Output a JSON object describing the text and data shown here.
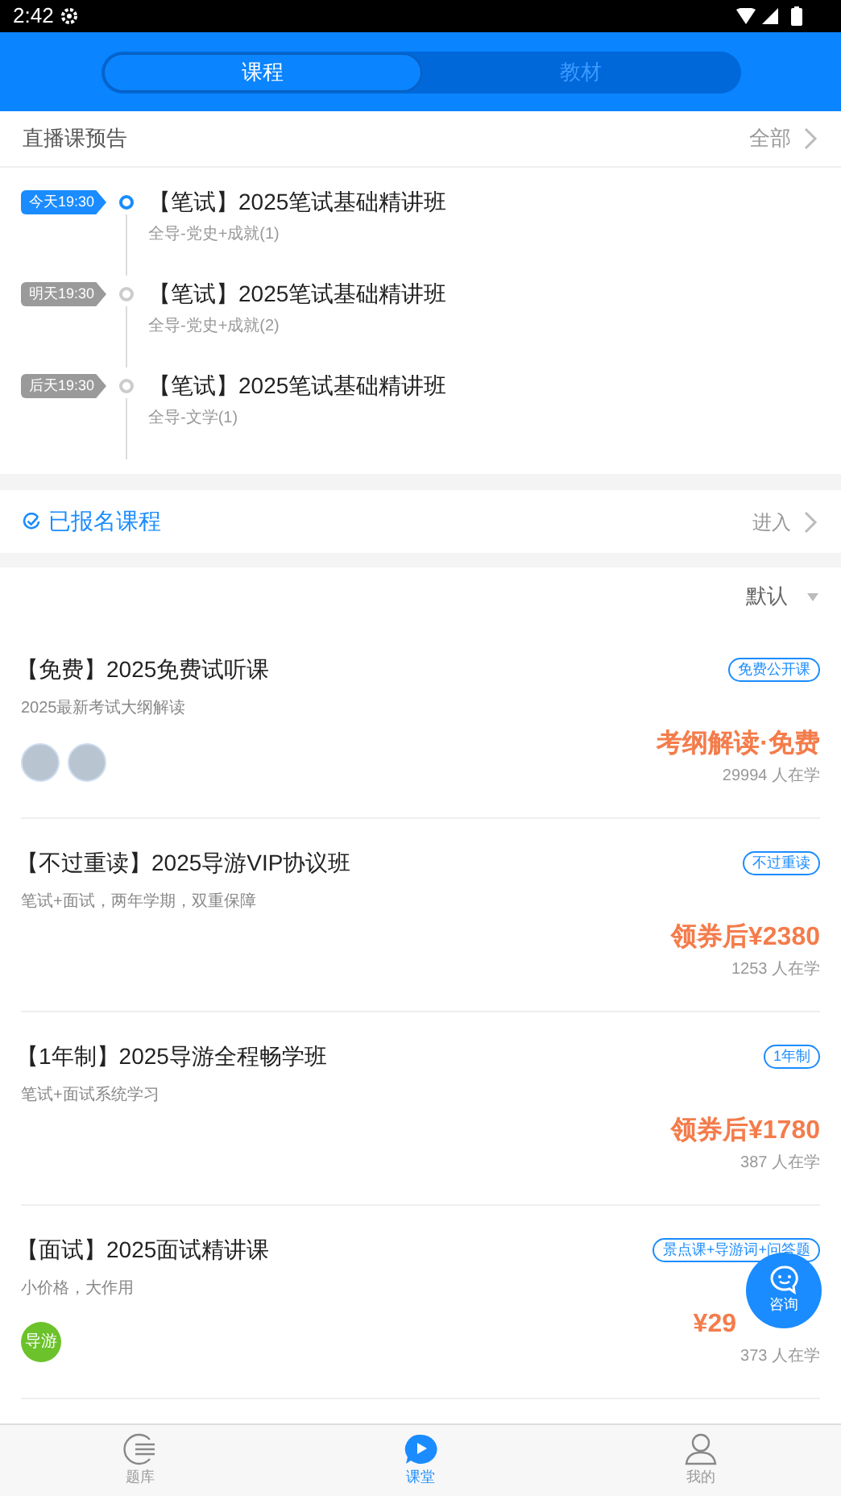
{
  "status_bar": {
    "time": "2:42"
  },
  "tabs": [
    {
      "label": "课程",
      "selected": true
    },
    {
      "label": "教材",
      "selected": false
    }
  ],
  "live_preview": {
    "title": "直播课预告",
    "more": "全部",
    "items": [
      {
        "time": "今天19:30",
        "title": "【笔试】2025笔试基础精讲班",
        "subtitle": "全导-党史+成就(1)",
        "active": true
      },
      {
        "time": "明天19:30",
        "title": "【笔试】2025笔试基础精讲班",
        "subtitle": "全导-党史+成就(2)",
        "active": false
      },
      {
        "time": "后天19:30",
        "title": "【笔试】2025笔试基础精讲班",
        "subtitle": "全导-文学(1)",
        "active": false
      }
    ]
  },
  "enrolled": {
    "title": "已报名课程",
    "action": "进入"
  },
  "sort": {
    "label": "默认"
  },
  "courses": [
    {
      "title": "【免费】2025免费试听课",
      "subtitle": "2025最新考试大纲解读",
      "tag": "免费公开课",
      "price": "考纲解读·免费",
      "learners": "29994 人在学",
      "avatars": [
        {
          "kind": "photo"
        },
        {
          "kind": "photo"
        }
      ]
    },
    {
      "title": "【不过重读】2025导游VIP协议班",
      "subtitle": "笔试+面试，两年学期，双重保障",
      "tag": "不过重读",
      "price": "领券后¥2380",
      "learners": "1253 人在学"
    },
    {
      "title": "【1年制】2025导游全程畅学班",
      "subtitle": "笔试+面试系统学习",
      "tag": "1年制",
      "price": "领券后¥1780",
      "learners": "387 人在学"
    },
    {
      "title": "【面试】2025面试精讲课",
      "subtitle": "小价格，大作用",
      "tag": "景点课+导游词+问答题",
      "price": "¥29",
      "learners": "373 人在学",
      "avatars": [
        {
          "kind": "logo",
          "text": "导游"
        }
      ]
    }
  ],
  "consult_button": {
    "label": "咨询"
  },
  "bottom_nav": [
    {
      "label": "题库",
      "selected": false
    },
    {
      "label": "课堂",
      "selected": true
    },
    {
      "label": "我的",
      "selected": false
    }
  ]
}
